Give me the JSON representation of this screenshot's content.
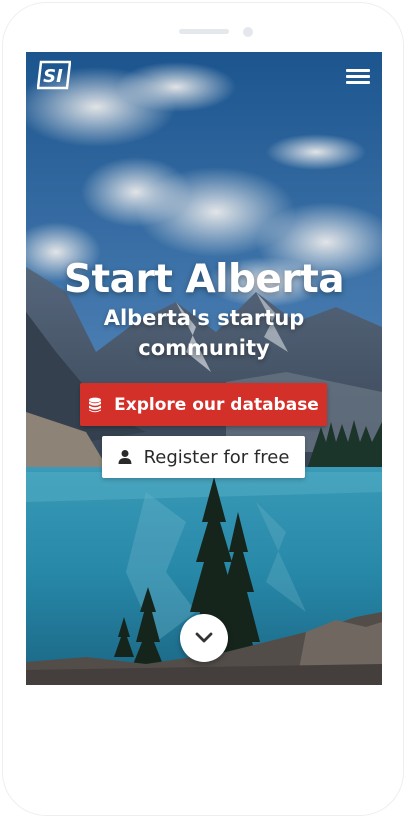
{
  "header": {
    "logo_alt": "SI",
    "logo_icon": "si-logo",
    "menu_icon": "hamburger-menu-icon"
  },
  "hero": {
    "title": "Start Alberta",
    "subtitle": "Alberta's startup community"
  },
  "buttons": {
    "explore_label": "Explore our database",
    "explore_icon": "database-icon",
    "register_label": "Register for free",
    "register_icon": "user-icon",
    "scroll_icon": "chevron-down-icon"
  },
  "colors": {
    "primary": "#d3302a",
    "text_on_primary": "#ffffff",
    "secondary_bg": "#ffffff",
    "secondary_text": "#2a2a2a"
  }
}
